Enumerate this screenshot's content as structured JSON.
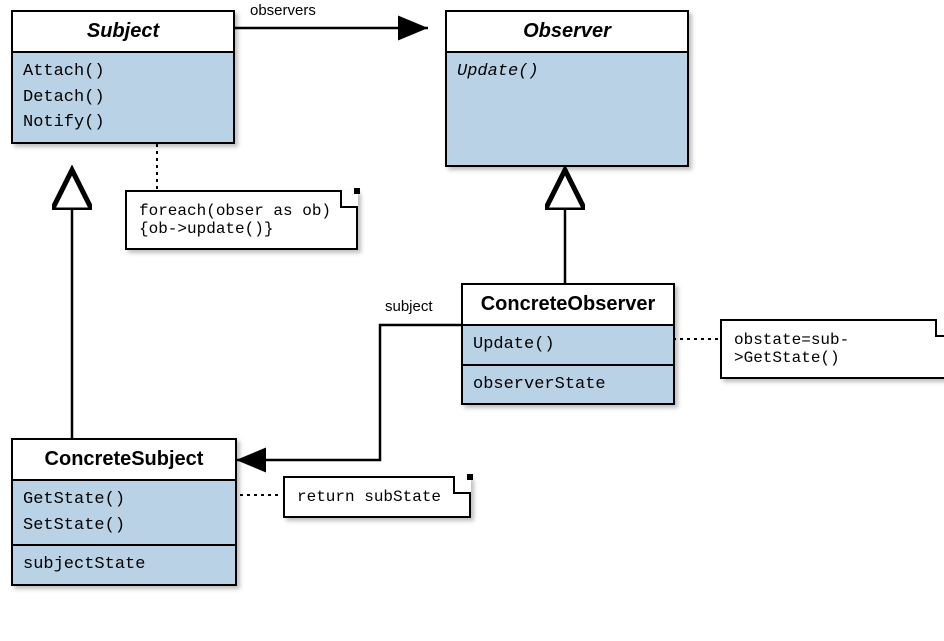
{
  "classes": {
    "subject": {
      "name": "Subject",
      "abstract": true,
      "ops": [
        "Attach()",
        "Detach()",
        "Notify()"
      ]
    },
    "observer": {
      "name": "Observer",
      "abstract": true,
      "ops": [
        "Update()"
      ],
      "ops_abstract": [
        true
      ]
    },
    "concreteSubject": {
      "name": "ConcreteSubject",
      "ops": [
        "GetState()",
        "SetState()"
      ],
      "attrs": [
        "subjectState"
      ]
    },
    "concreteObserver": {
      "name": "ConcreteObserver",
      "ops": [
        "Update()"
      ],
      "attrs": [
        "observerState"
      ]
    }
  },
  "notes": {
    "notifyNote": "foreach(obser as ob)\n{ob->update()}",
    "getStateNote": "return subState",
    "updateNote": "obstate=sub->GetState()"
  },
  "labels": {
    "observers": "observers",
    "subject": "subject"
  },
  "relationships": [
    {
      "from": "Subject",
      "to": "Observer",
      "type": "association",
      "label": "observers",
      "end": "filled-circle-arrow"
    },
    {
      "from": "ConcreteSubject",
      "to": "Subject",
      "type": "generalization"
    },
    {
      "from": "ConcreteObserver",
      "to": "Observer",
      "type": "generalization"
    },
    {
      "from": "ConcreteObserver",
      "to": "ConcreteSubject",
      "type": "association",
      "label": "subject",
      "end": "arrow"
    },
    {
      "from": "Subject.Notify()",
      "to": "note.notifyNote",
      "type": "note-anchor"
    },
    {
      "from": "ConcreteSubject.GetState()",
      "to": "note.getStateNote",
      "type": "note-anchor"
    },
    {
      "from": "ConcreteObserver.Update()",
      "to": "note.updateNote",
      "type": "note-anchor"
    }
  ]
}
